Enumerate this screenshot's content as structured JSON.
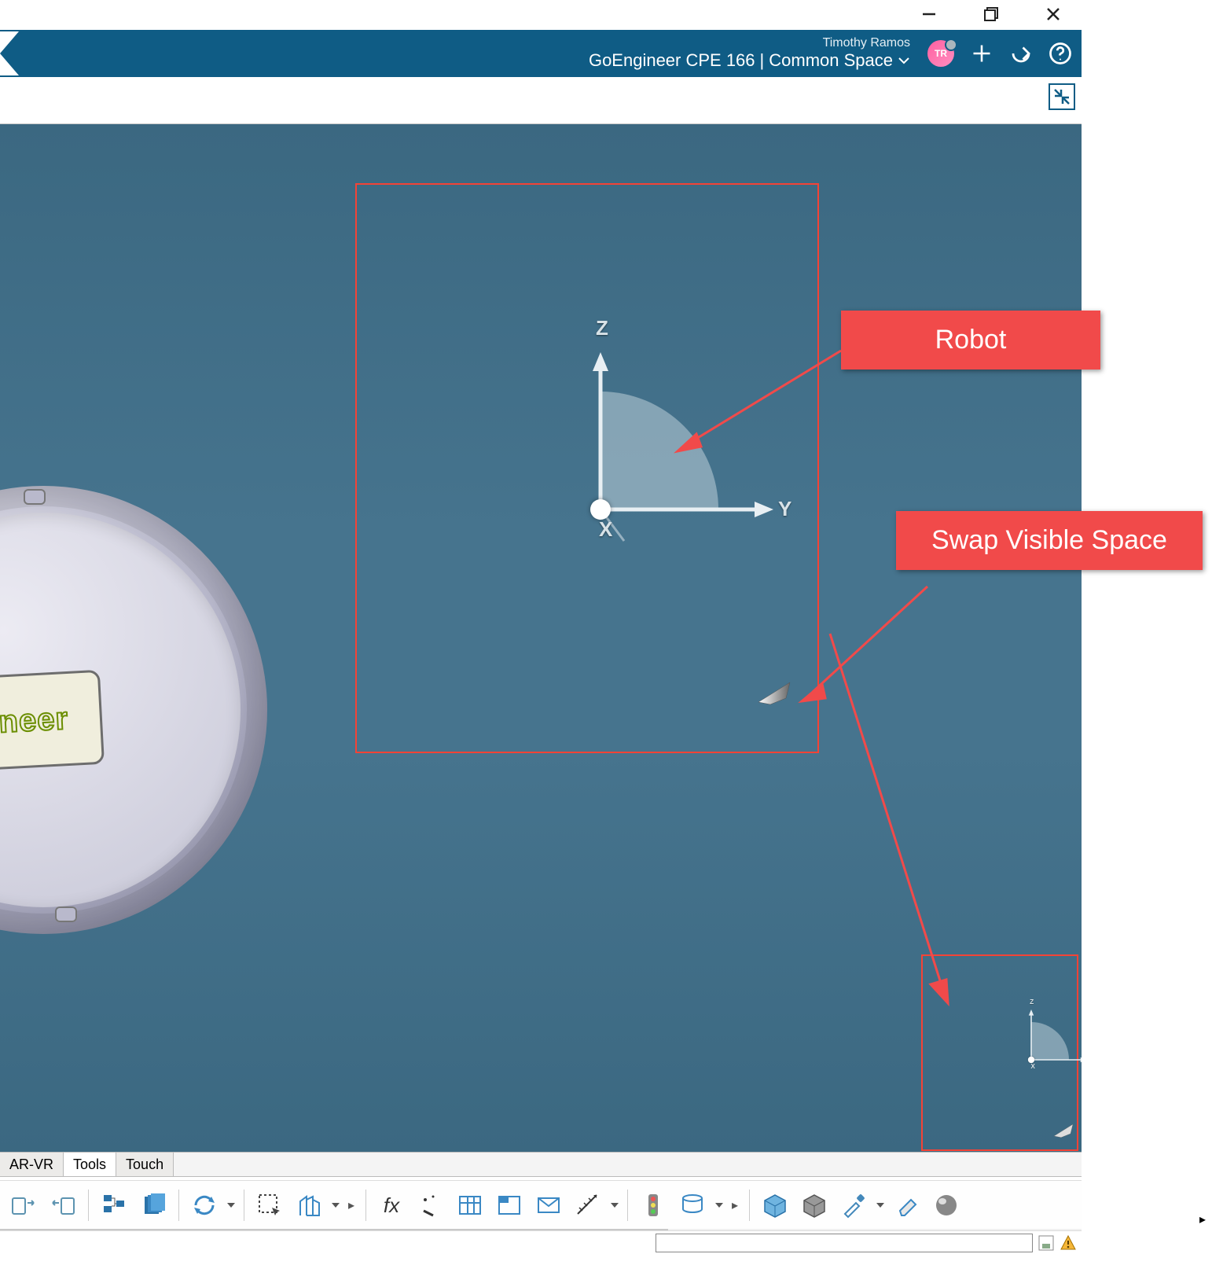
{
  "window": {
    "minimize": "—",
    "maximize": "❐",
    "close": "✕"
  },
  "header": {
    "user_name": "Timothy Ramos",
    "breadcrumb_org": "GoEngineer CPE 166",
    "breadcrumb_sep": "|",
    "breadcrumb_space": "Common Space",
    "avatar_initials": "TR"
  },
  "viewport": {
    "axes": {
      "x": "X",
      "y": "Y",
      "z": "Z"
    },
    "part_label": "gineer"
  },
  "callouts": {
    "robot": "Robot",
    "swap": "Swap Visible Space"
  },
  "tabs": {
    "arvr": "AR-VR",
    "tools": "Tools",
    "touch": "Touch"
  },
  "toolbar": {
    "fx": "fx"
  },
  "icons": {
    "plus": "plus-icon",
    "share": "share-icon",
    "help": "help-icon",
    "fullscreen": "restore-icon"
  },
  "colors": {
    "header": "#0f5c85",
    "callout": "#f14a4a",
    "highlight": "#f44336",
    "viewport": "#46748e"
  }
}
